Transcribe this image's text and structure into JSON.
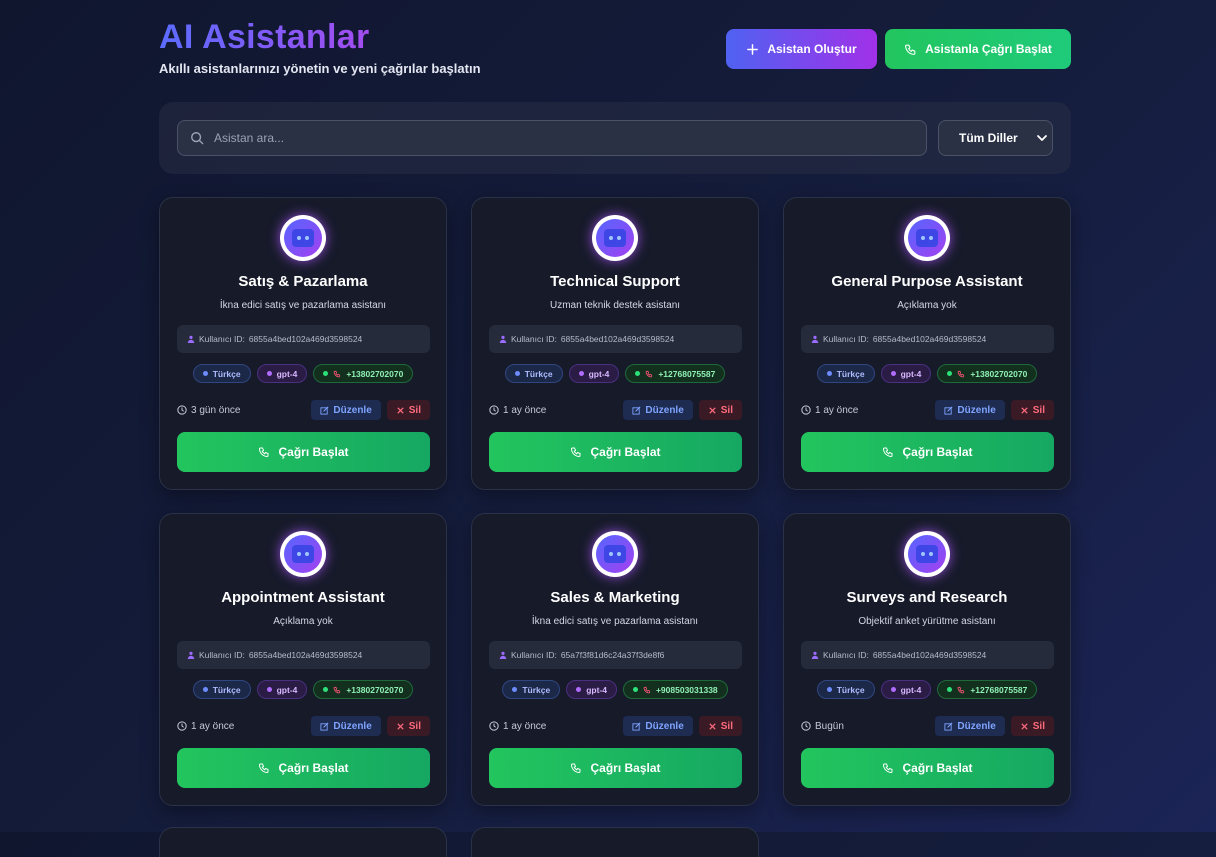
{
  "header": {
    "title": "AI Asistanlar",
    "subtitle": "Akıllı asistanlarınızı yönetin ve yeni çağrılar başlatın",
    "create_label": "Asistan Oluştur",
    "call_label": "Asistanla Çağrı Başlat"
  },
  "search": {
    "placeholder": "Asistan ara...",
    "language_filter": "Tüm Diller"
  },
  "labels": {
    "user_id_prefix": "Kullanıcı ID:",
    "edit": "Düzenle",
    "delete": "Sil",
    "start_call": "Çağrı Başlat"
  },
  "colors": {
    "accent_blue": "#4f62f2",
    "accent_purple": "#a131e8",
    "success_green": "#22c55e",
    "danger_red": "#ff6a7d"
  },
  "assistants": [
    {
      "name": "Satış & Pazarlama",
      "description": "İkna edici satış ve pazarlama asistanı",
      "user_id": "6855a4bed102a469d3598524",
      "language": "Türkçe",
      "model": "gpt-4",
      "phone": "+13802702070",
      "time": "3 gün önce"
    },
    {
      "name": "Technical Support",
      "description": "Uzman teknik destek asistanı",
      "user_id": "6855a4bed102a469d3598524",
      "language": "Türkçe",
      "model": "gpt-4",
      "phone": "+12768075587",
      "time": "1 ay önce"
    },
    {
      "name": "General Purpose Assistant",
      "description": "Açıklama yok",
      "user_id": "6855a4bed102a469d3598524",
      "language": "Türkçe",
      "model": "gpt-4",
      "phone": "+13802702070",
      "time": "1 ay önce"
    },
    {
      "name": "Appointment Assistant",
      "description": "Açıklama yok",
      "user_id": "6855a4bed102a469d3598524",
      "language": "Türkçe",
      "model": "gpt-4",
      "phone": "+13802702070",
      "time": "1 ay önce"
    },
    {
      "name": "Sales & Marketing",
      "description": "İkna edici satış ve pazarlama asistanı",
      "user_id": "65a7f3f81d6c24a37f3de8f6",
      "language": "Türkçe",
      "model": "gpt-4",
      "phone": "+908503031338",
      "time": "1 ay önce"
    },
    {
      "name": "Surveys and Research",
      "description": "Objektif anket yürütme asistanı",
      "user_id": "6855a4bed102a469d3598524",
      "language": "Türkçe",
      "model": "gpt-4",
      "phone": "+12768075587",
      "time": "Bugün"
    }
  ]
}
